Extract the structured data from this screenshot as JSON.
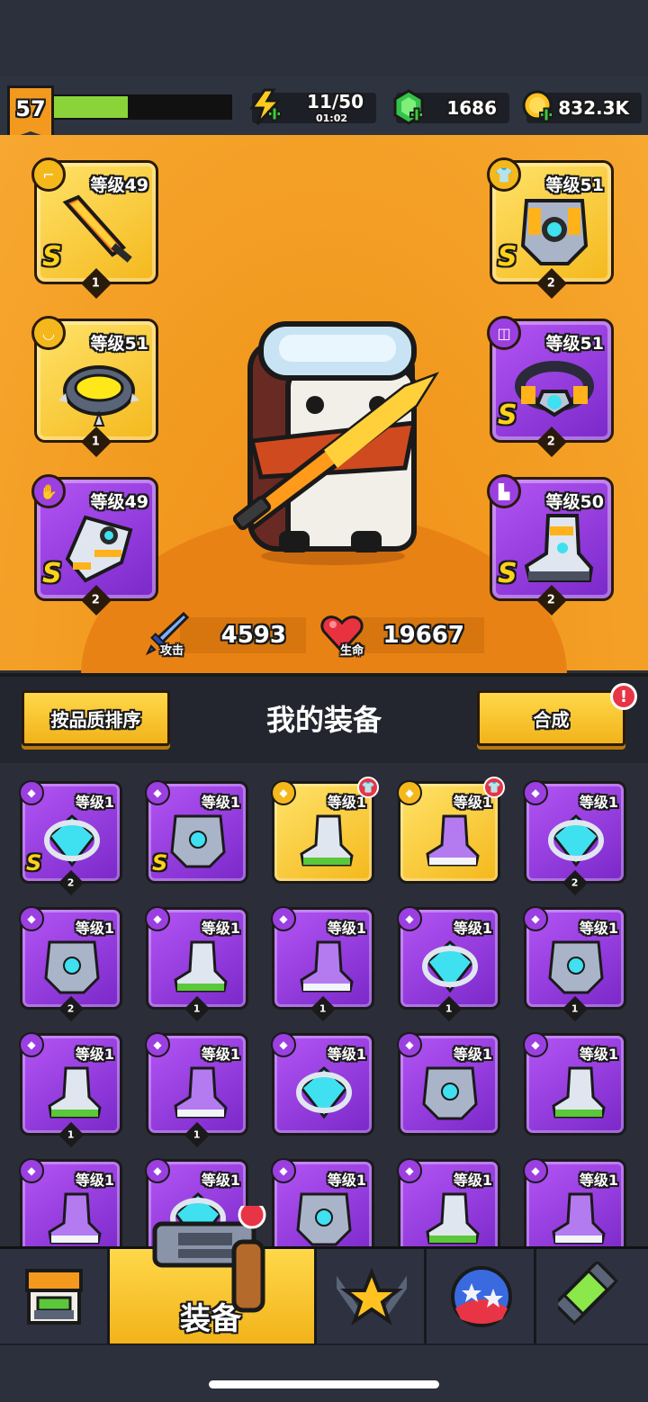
{
  "player": {
    "level": "57",
    "xp_progress": 0.42
  },
  "resources": {
    "energy": {
      "value": "11/50",
      "timer": "01:02",
      "icon": "lightning-icon"
    },
    "gems": {
      "value": "1686",
      "icon": "gem-icon"
    },
    "coins": {
      "value": "832.3K",
      "icon": "coin-icon"
    }
  },
  "equipped": {
    "weapon": {
      "level": "等级49",
      "grade": "S",
      "count": "1",
      "rarity": "gold",
      "type_icon": "gun-icon"
    },
    "armor": {
      "level": "等级51",
      "grade": "S",
      "count": "2",
      "rarity": "gold",
      "type_icon": "shirt-icon"
    },
    "necklace": {
      "level": "等级51",
      "grade": "",
      "count": "1",
      "rarity": "gold",
      "type_icon": "necklace-icon"
    },
    "belt": {
      "level": "等级51",
      "grade": "S",
      "count": "2",
      "rarity": "purple",
      "type_icon": "belt-icon"
    },
    "gloves": {
      "level": "等级49",
      "grade": "S",
      "count": "2",
      "rarity": "purple",
      "type_icon": "glove-icon"
    },
    "boots": {
      "level": "等级50",
      "grade": "S",
      "count": "2",
      "rarity": "purple",
      "type_icon": "boot-icon"
    }
  },
  "stats": {
    "attack_label": "攻击",
    "attack": "4593",
    "hp_label": "生命",
    "hp": "19667"
  },
  "bag": {
    "sort_label": "按品质排序",
    "title": "我的装备",
    "merge_label": "合成",
    "alert": "!",
    "items": [
      {
        "level": "等级1",
        "grade": "S",
        "count": "2",
        "rarity": "purple",
        "new": false
      },
      {
        "level": "等级1",
        "grade": "S",
        "count": "",
        "rarity": "purple",
        "new": false
      },
      {
        "level": "等级1",
        "grade": "",
        "count": "",
        "rarity": "gold",
        "new": true
      },
      {
        "level": "等级1",
        "grade": "",
        "count": "",
        "rarity": "gold",
        "new": true
      },
      {
        "level": "等级1",
        "grade": "",
        "count": "2",
        "rarity": "purple",
        "new": false
      },
      {
        "level": "等级1",
        "grade": "",
        "count": "2",
        "rarity": "purple",
        "new": false
      },
      {
        "level": "等级1",
        "grade": "",
        "count": "1",
        "rarity": "purple",
        "new": false
      },
      {
        "level": "等级1",
        "grade": "",
        "count": "1",
        "rarity": "purple",
        "new": false
      },
      {
        "level": "等级1",
        "grade": "",
        "count": "1",
        "rarity": "purple",
        "new": false
      },
      {
        "level": "等级1",
        "grade": "",
        "count": "1",
        "rarity": "purple",
        "new": false
      },
      {
        "level": "等级1",
        "grade": "",
        "count": "1",
        "rarity": "purple",
        "new": false
      },
      {
        "level": "等级1",
        "grade": "",
        "count": "1",
        "rarity": "purple",
        "new": false
      },
      {
        "level": "等级1",
        "grade": "",
        "count": "",
        "rarity": "purple",
        "new": false
      },
      {
        "level": "等级1",
        "grade": "",
        "count": "",
        "rarity": "purple",
        "new": false
      },
      {
        "level": "等级1",
        "grade": "",
        "count": "",
        "rarity": "purple",
        "new": false
      },
      {
        "level": "等级1",
        "grade": "",
        "count": "",
        "rarity": "purple",
        "new": false
      },
      {
        "level": "等级1",
        "grade": "",
        "count": "",
        "rarity": "purple",
        "new": false
      },
      {
        "level": "等级1",
        "grade": "",
        "count": "",
        "rarity": "purple",
        "new": false
      },
      {
        "level": "等级1",
        "grade": "",
        "count": "",
        "rarity": "purple",
        "new": false
      },
      {
        "level": "等级1",
        "grade": "",
        "count": "",
        "rarity": "purple",
        "new": false
      }
    ]
  },
  "nav": {
    "active_label": "装备",
    "tabs": [
      "shop-icon",
      "equipment-icon",
      "star-swords-icon",
      "orbs-icon",
      "capsule-icon"
    ]
  }
}
